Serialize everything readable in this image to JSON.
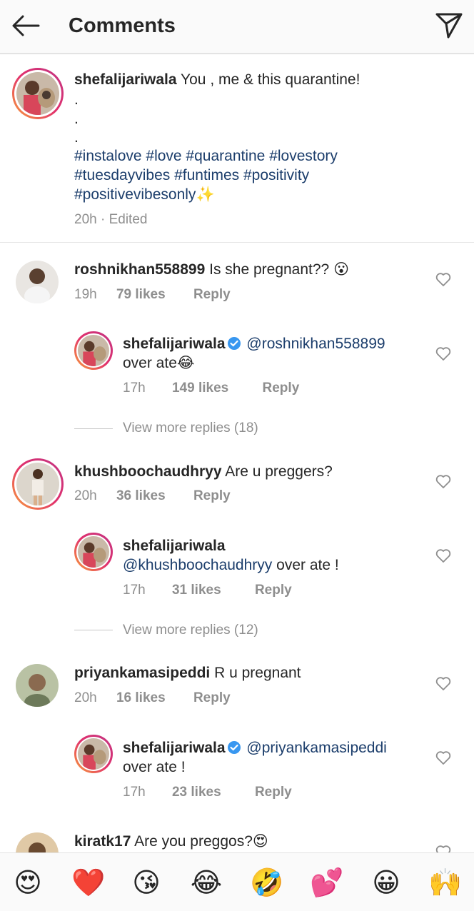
{
  "header": {
    "title": "Comments"
  },
  "caption": {
    "username": "shefalijariwala",
    "text": "You , me & this quarantine!",
    "dots": [
      ".",
      ".",
      "."
    ],
    "hashtags_line1": "#instalove #love #quarantine #lovestory",
    "hashtags_line2": "#tuesdayvibes #funtimes #positivity",
    "hashtags_line3": "#positivevibesonly",
    "sparkle": "✨",
    "meta": "20h · Edited"
  },
  "comments": [
    {
      "username": "roshnikhan558899",
      "text": "Is she pregnant??",
      "emoji": "😮",
      "time": "19h",
      "likes": "79 likes",
      "reply": "Reply",
      "reply_item": {
        "username": "shefalijariwala",
        "mention": "@roshnikhan558899",
        "text": "over ate",
        "emoji": "😂",
        "time": "17h",
        "likes": "149 likes",
        "reply": "Reply"
      },
      "view_more": "View more replies (18)"
    },
    {
      "username": "khushboochaudhryy",
      "text": "Are u preggers?",
      "time": "20h",
      "likes": "36 likes",
      "reply": "Reply",
      "reply_item": {
        "username": "shefalijariwala",
        "mention": "@khushboochaudhryy",
        "text": "over ate !",
        "time": "17h",
        "likes": "31 likes",
        "reply": "Reply"
      },
      "view_more": "View more replies (12)"
    },
    {
      "username": "priyankamasipeddi",
      "text": "R u pregnant",
      "time": "20h",
      "likes": "16 likes",
      "reply": "Reply",
      "reply_item": {
        "username": "shefalijariwala",
        "mention": "@priyankamasipeddi",
        "text": "over ate !",
        "time": "17h",
        "likes": "23 likes",
        "reply": "Reply"
      }
    },
    {
      "username": "kiratk17",
      "text": "Are you preggos?",
      "emoji": "😍"
    }
  ],
  "emoji_bar": [
    "😍",
    "❤️",
    "😘",
    "😂",
    "🤣",
    "💕",
    "😀",
    "🙌"
  ]
}
